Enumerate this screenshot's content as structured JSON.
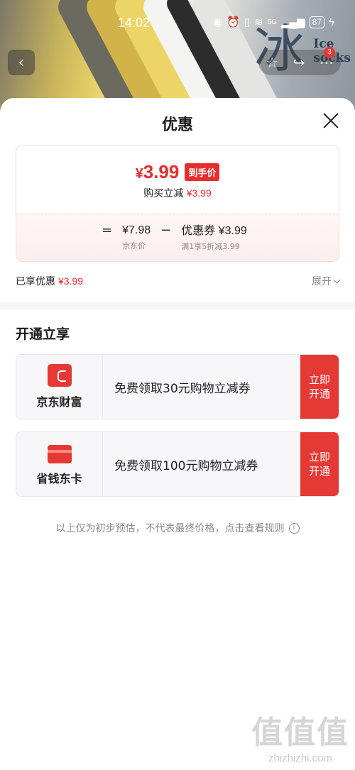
{
  "status_bar": {
    "time": "14:02",
    "battery": "87",
    "network": "5G"
  },
  "background": {
    "brand_glyph": "冰",
    "ice_text_line1": "Ice",
    "ice_text_line2": "socks",
    "cart_badge": "3"
  },
  "sheet": {
    "title": "优惠",
    "final_price": {
      "currency": "¥",
      "value": "3.99",
      "tag": "到手价"
    },
    "instant_discount": {
      "label": "购买立减",
      "amount": "¥3.99"
    },
    "formula": {
      "equals": "=",
      "minus": "−",
      "jd_price": {
        "value": "¥7.98",
        "caption": "京东价"
      },
      "coupon": {
        "label": "优惠券",
        "value": "¥3.99",
        "caption": "满1享5折减3.99"
      }
    },
    "enjoyed": {
      "label": "已享优惠",
      "amount": "¥3.99"
    },
    "expand_label": "展开",
    "section_title": "开通立享",
    "offers": [
      {
        "name": "京东财富",
        "description": "免费领取30元购物立减券",
        "button": "立即开通",
        "icon": "wallet-icon"
      },
      {
        "name": "省钱东卡",
        "description": "免费领取100元购物立减券",
        "button": "立即开通",
        "icon": "card-icon"
      }
    ],
    "disclaimer": "以上仅为初步预估，不代表最终价格，点击查看规则"
  },
  "watermark": {
    "logo": "值值值",
    "url": "zhizhizhi.com"
  },
  "colors": {
    "accent": "#e52e2e",
    "muted": "#888888"
  }
}
